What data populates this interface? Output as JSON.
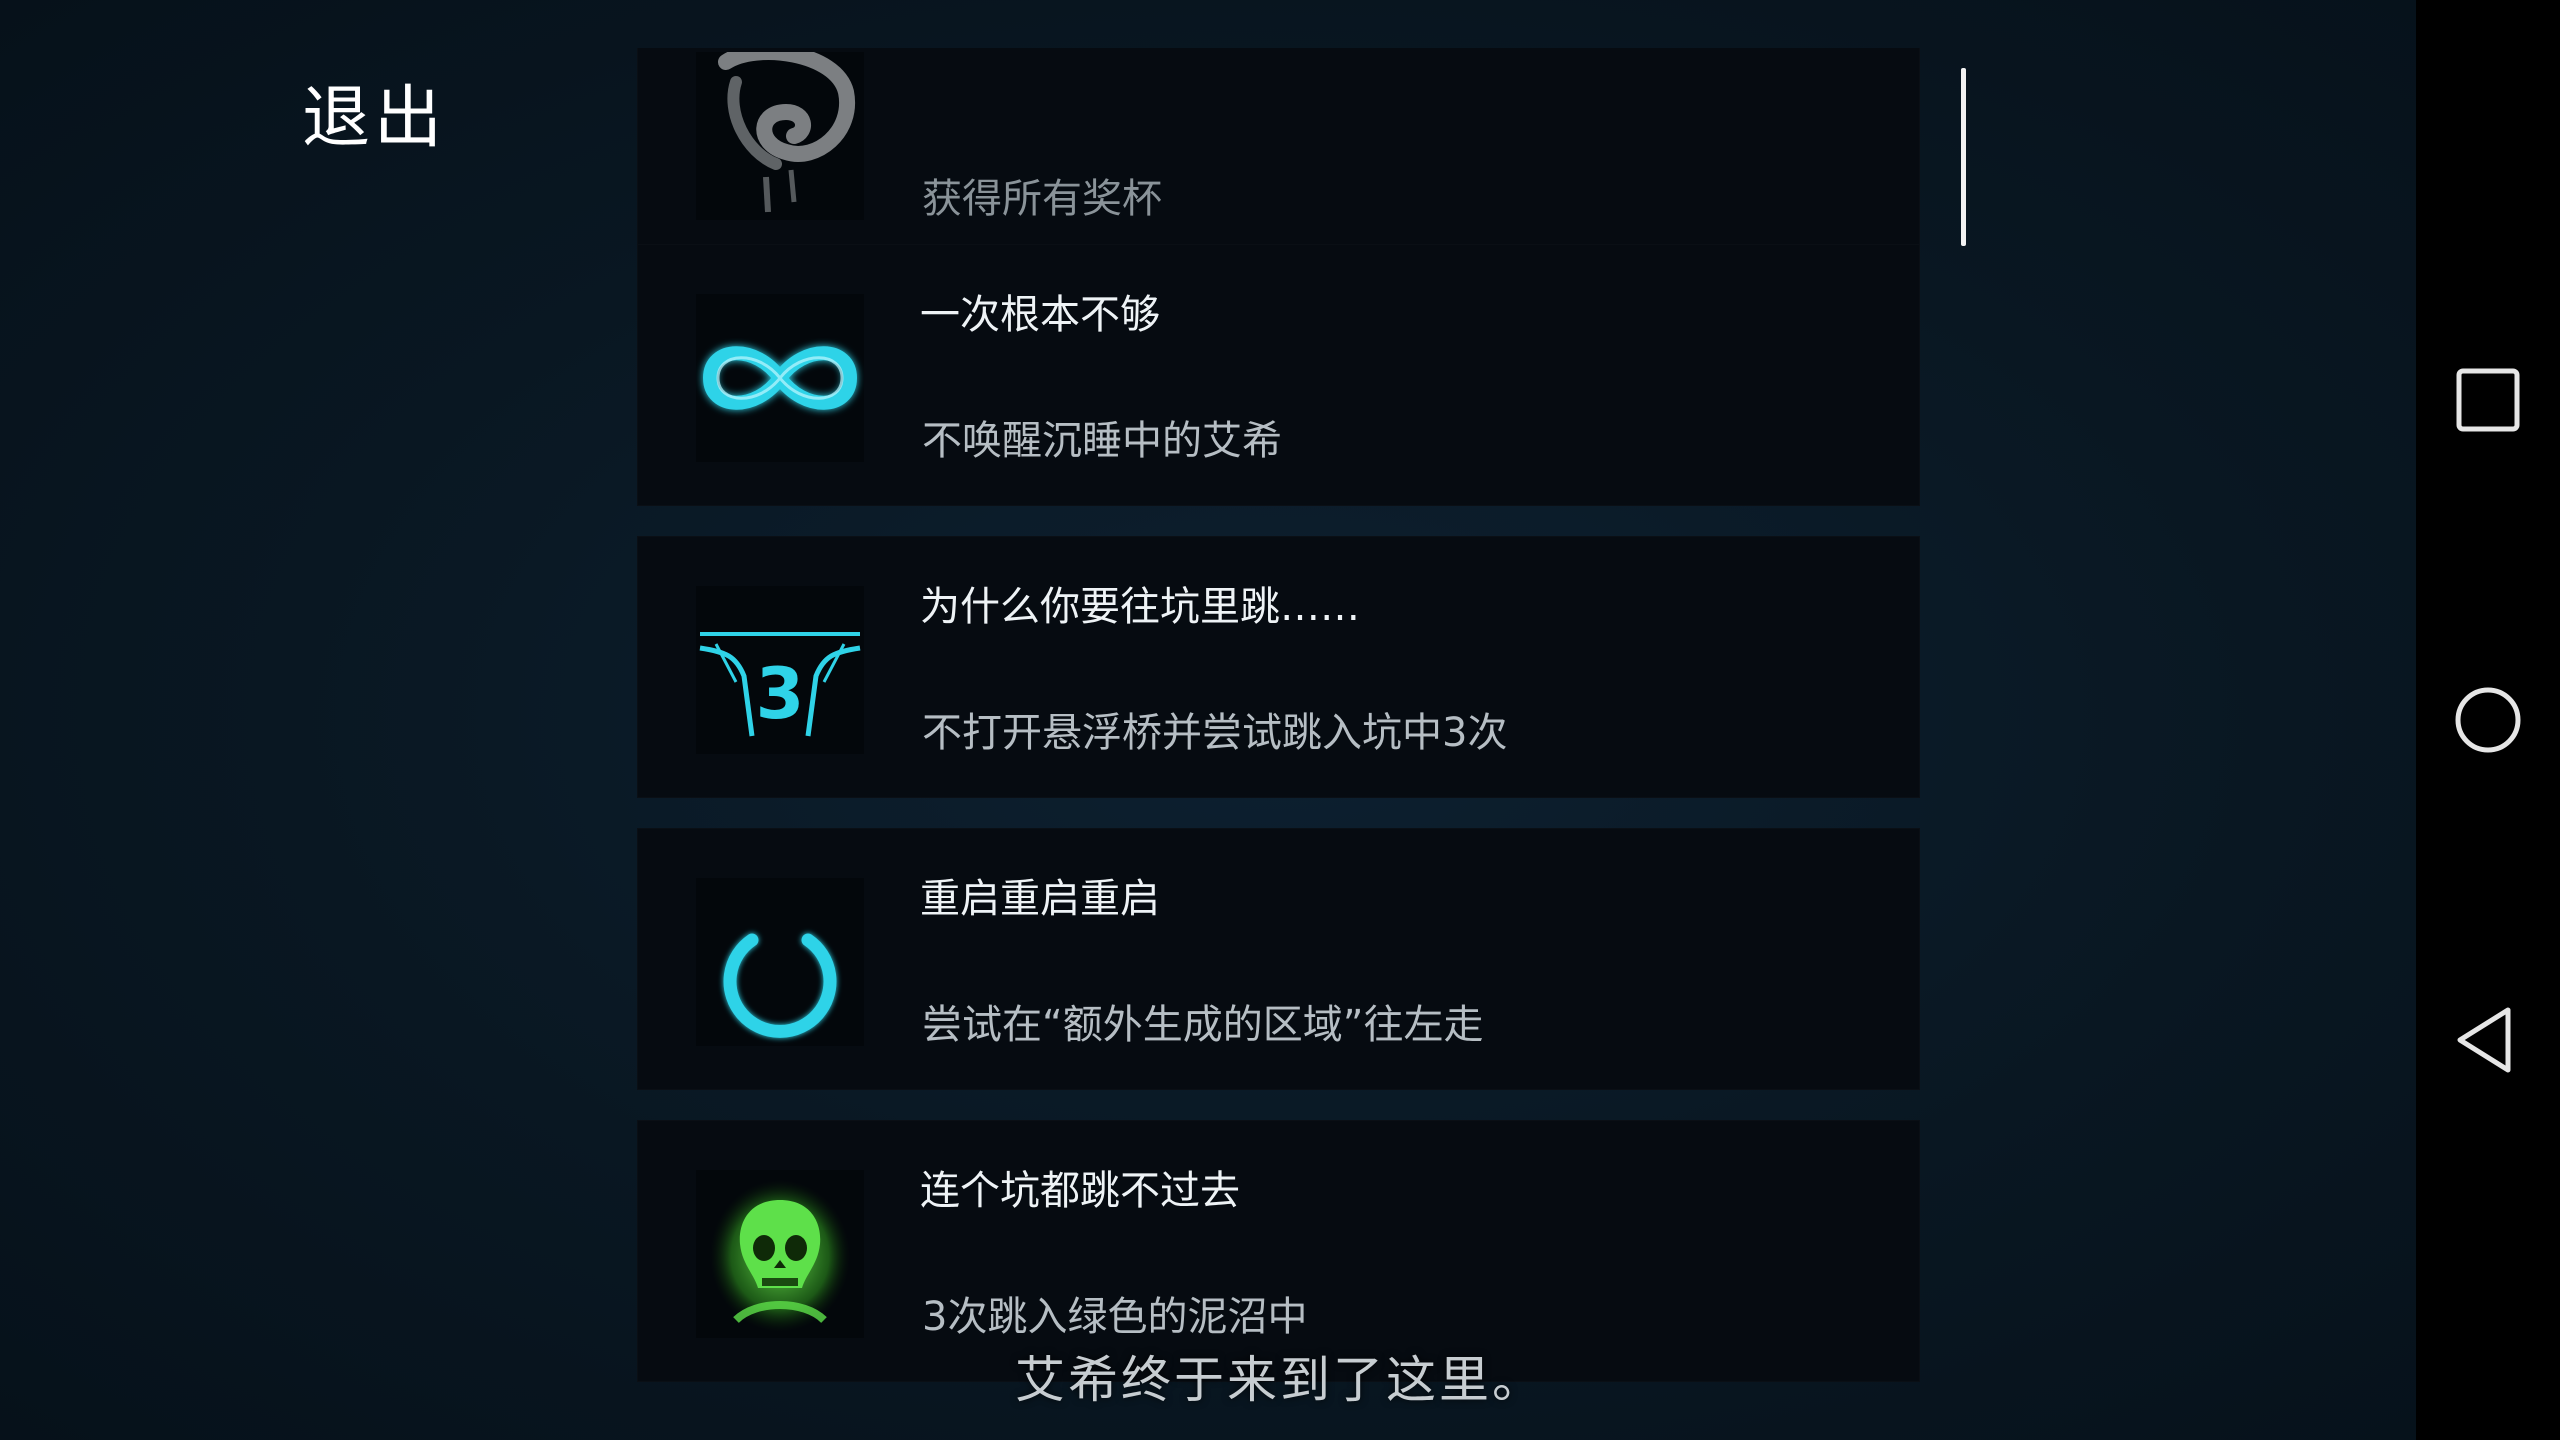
{
  "exit_label": "退出",
  "achievements": [
    {
      "icon": "trophy-swirl-icon",
      "title": "",
      "description": "获得所有奖杯"
    },
    {
      "icon": "infinity-icon",
      "title": "一次根本不够",
      "description": "不唤醒沉睡中的艾希"
    },
    {
      "icon": "pit-three-icon",
      "title": "为什么你要往坑里跳……",
      "description": "不打开悬浮桥并尝试跳入坑中3次"
    },
    {
      "icon": "power-icon",
      "title": "重启重启重启",
      "description": "尝试在“额外生成的区域”往左走"
    },
    {
      "icon": "green-skull-icon",
      "title": "连个坑都跳不过去",
      "description": "3次跳入绿色的泥沼中"
    }
  ],
  "badge_number": "3",
  "subtitle": "艾希终于来到了这里。",
  "navigation": {
    "recents": "square-icon",
    "home": "circle-icon",
    "back": "triangle-back-icon"
  },
  "colors": {
    "accent_cyan": "#2fd3e8",
    "skull_green": "#5ee04a",
    "background": "#0a1620"
  }
}
